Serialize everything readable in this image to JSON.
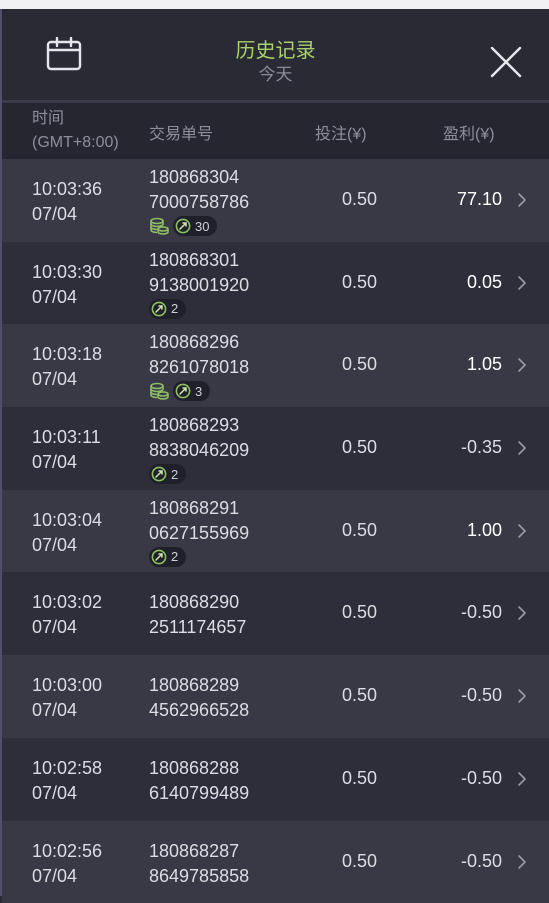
{
  "header": {
    "title": "历史记录",
    "subtitle": "今天",
    "calendar_icon": "calendar-icon",
    "close_icon": "close-icon"
  },
  "columns": {
    "time": "时间",
    "timezone": "(GMT+8:00)",
    "order": "交易单号",
    "bet": "投注(¥)",
    "profit": "盈利(¥)"
  },
  "colors": {
    "title": "#a7d26b",
    "coin_icon": "#8fbf63",
    "row_odd": "#383945",
    "row_even": "#2d2e3a"
  },
  "rows": [
    {
      "time": "10:03:36",
      "date": "07/04",
      "order1": "180868304",
      "order2": "7000758786",
      "bet": "0.50",
      "profit": "77.10",
      "coin": true,
      "count": "30"
    },
    {
      "time": "10:03:30",
      "date": "07/04",
      "order1": "180868301",
      "order2": "9138001920",
      "bet": "0.50",
      "profit": "0.05",
      "coin": false,
      "count": "2"
    },
    {
      "time": "10:03:18",
      "date": "07/04",
      "order1": "180868296",
      "order2": "8261078018",
      "bet": "0.50",
      "profit": "1.05",
      "coin": true,
      "count": "3"
    },
    {
      "time": "10:03:11",
      "date": "07/04",
      "order1": "180868293",
      "order2": "8838046209",
      "bet": "0.50",
      "profit": "-0.35",
      "coin": false,
      "count": "2"
    },
    {
      "time": "10:03:04",
      "date": "07/04",
      "order1": "180868291",
      "order2": "0627155969",
      "bet": "0.50",
      "profit": "1.00",
      "coin": false,
      "count": "2"
    },
    {
      "time": "10:03:02",
      "date": "07/04",
      "order1": "180868290",
      "order2": "2511174657",
      "bet": "0.50",
      "profit": "-0.50",
      "coin": false,
      "count": ""
    },
    {
      "time": "10:03:00",
      "date": "07/04",
      "order1": "180868289",
      "order2": "4562966528",
      "bet": "0.50",
      "profit": "-0.50",
      "coin": false,
      "count": ""
    },
    {
      "time": "10:02:58",
      "date": "07/04",
      "order1": "180868288",
      "order2": "6140799489",
      "bet": "0.50",
      "profit": "-0.50",
      "coin": false,
      "count": ""
    },
    {
      "time": "10:02:56",
      "date": "07/04",
      "order1": "180868287",
      "order2": "8649785858",
      "bet": "0.50",
      "profit": "-0.50",
      "coin": false,
      "count": ""
    }
  ]
}
